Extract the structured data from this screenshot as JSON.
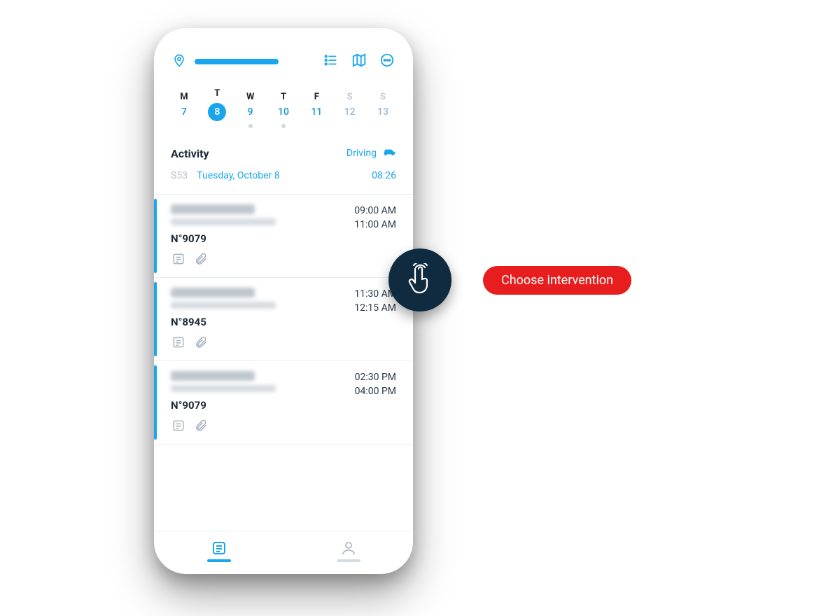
{
  "callout": {
    "label": "Choose intervention"
  },
  "calendar": {
    "dows": [
      "M",
      "T",
      "W",
      "T",
      "F",
      "S",
      "S"
    ],
    "days": [
      "7",
      "8",
      "9",
      "10",
      "11",
      "12",
      "13"
    ],
    "selected_index": 1,
    "dots_at": [
      2,
      3
    ]
  },
  "activity": {
    "title": "Activity",
    "status_label": "Driving",
    "week_code": "S53",
    "date_text": "Tuesday, October 8",
    "time": "08:26"
  },
  "interventions": [
    {
      "ref": "N°9079",
      "start": "09:00 AM",
      "end": "11:00 AM"
    },
    {
      "ref": "N°8945",
      "start": "11:30 AM",
      "end": "12:15 AM"
    },
    {
      "ref": "N°9079",
      "start": "02:30 PM",
      "end": "04:00 PM"
    }
  ]
}
